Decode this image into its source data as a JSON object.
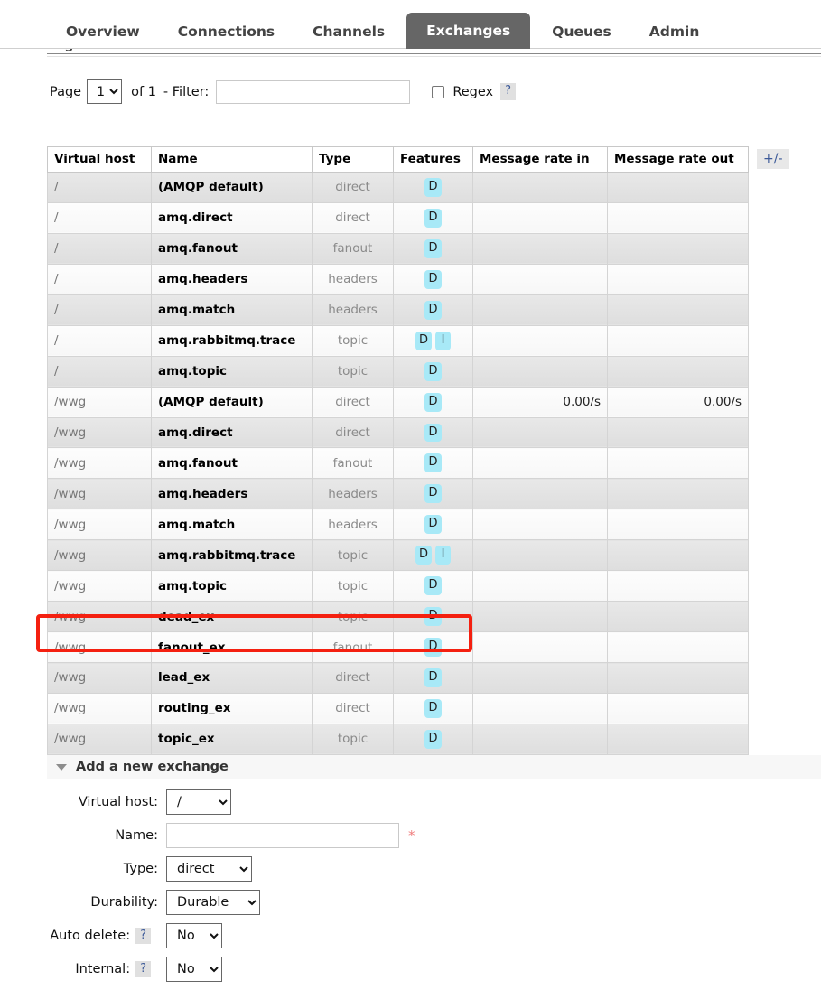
{
  "nav": {
    "tabs": [
      {
        "label": "Overview",
        "active": false
      },
      {
        "label": "Connections",
        "active": false
      },
      {
        "label": "Channels",
        "active": false
      },
      {
        "label": "Exchanges",
        "active": true
      },
      {
        "label": "Queues",
        "active": false
      },
      {
        "label": "Admin",
        "active": false
      }
    ]
  },
  "pagination": {
    "section_label": "Pagination",
    "page_label": "Page",
    "page_value": "1",
    "of_label": "of 1",
    "filter_label": "- Filter:",
    "filter_value": "",
    "filter_placeholder": "",
    "regex_label": "Regex",
    "regex_checked": false,
    "help_label": "?"
  },
  "table": {
    "columns": [
      "Virtual host",
      "Name",
      "Type",
      "Features",
      "Message rate in",
      "Message rate out"
    ],
    "plus_minus_label": "+/-",
    "rows": [
      {
        "vhost": "/",
        "name": "(AMQP default)",
        "type": "direct",
        "features": [
          "D"
        ],
        "rate_in": "",
        "rate_out": ""
      },
      {
        "vhost": "/",
        "name": "amq.direct",
        "type": "direct",
        "features": [
          "D"
        ],
        "rate_in": "",
        "rate_out": ""
      },
      {
        "vhost": "/",
        "name": "amq.fanout",
        "type": "fanout",
        "features": [
          "D"
        ],
        "rate_in": "",
        "rate_out": ""
      },
      {
        "vhost": "/",
        "name": "amq.headers",
        "type": "headers",
        "features": [
          "D"
        ],
        "rate_in": "",
        "rate_out": ""
      },
      {
        "vhost": "/",
        "name": "amq.match",
        "type": "headers",
        "features": [
          "D"
        ],
        "rate_in": "",
        "rate_out": ""
      },
      {
        "vhost": "/",
        "name": "amq.rabbitmq.trace",
        "type": "topic",
        "features": [
          "D",
          "I"
        ],
        "rate_in": "",
        "rate_out": ""
      },
      {
        "vhost": "/",
        "name": "amq.topic",
        "type": "topic",
        "features": [
          "D"
        ],
        "rate_in": "",
        "rate_out": ""
      },
      {
        "vhost": "/wwg",
        "name": "(AMQP default)",
        "type": "direct",
        "features": [
          "D"
        ],
        "rate_in": "0.00/s",
        "rate_out": "0.00/s"
      },
      {
        "vhost": "/wwg",
        "name": "amq.direct",
        "type": "direct",
        "features": [
          "D"
        ],
        "rate_in": "",
        "rate_out": ""
      },
      {
        "vhost": "/wwg",
        "name": "amq.fanout",
        "type": "fanout",
        "features": [
          "D"
        ],
        "rate_in": "",
        "rate_out": ""
      },
      {
        "vhost": "/wwg",
        "name": "amq.headers",
        "type": "headers",
        "features": [
          "D"
        ],
        "rate_in": "",
        "rate_out": ""
      },
      {
        "vhost": "/wwg",
        "name": "amq.match",
        "type": "headers",
        "features": [
          "D"
        ],
        "rate_in": "",
        "rate_out": ""
      },
      {
        "vhost": "/wwg",
        "name": "amq.rabbitmq.trace",
        "type": "topic",
        "features": [
          "D",
          "I"
        ],
        "rate_in": "",
        "rate_out": ""
      },
      {
        "vhost": "/wwg",
        "name": "amq.topic",
        "type": "topic",
        "features": [
          "D"
        ],
        "rate_in": "",
        "rate_out": ""
      },
      {
        "vhost": "/wwg",
        "name": "dead_ex",
        "type": "topic",
        "features": [
          "D"
        ],
        "rate_in": "",
        "rate_out": ""
      },
      {
        "vhost": "/wwg",
        "name": "fanout_ex",
        "type": "fanout",
        "features": [
          "D"
        ],
        "rate_in": "",
        "rate_out": "",
        "highlighted": true
      },
      {
        "vhost": "/wwg",
        "name": "lead_ex",
        "type": "direct",
        "features": [
          "D"
        ],
        "rate_in": "",
        "rate_out": ""
      },
      {
        "vhost": "/wwg",
        "name": "routing_ex",
        "type": "direct",
        "features": [
          "D"
        ],
        "rate_in": "",
        "rate_out": ""
      },
      {
        "vhost": "/wwg",
        "name": "topic_ex",
        "type": "topic",
        "features": [
          "D"
        ],
        "rate_in": "",
        "rate_out": ""
      }
    ]
  },
  "add_exchange": {
    "section_title": "Add a new exchange",
    "fields": {
      "vhost": {
        "label": "Virtual host:",
        "value": "/"
      },
      "name": {
        "label": "Name:",
        "value": "",
        "placeholder": "",
        "required_marker": "*"
      },
      "type": {
        "label": "Type:",
        "value": "direct"
      },
      "durability": {
        "label": "Durability:",
        "value": "Durable"
      },
      "auto_delete": {
        "label": "Auto delete:",
        "value": "No",
        "help": "?"
      },
      "internal": {
        "label": "Internal:",
        "value": "No",
        "help": "?"
      }
    }
  },
  "colors": {
    "active_tab_bg": "#666666",
    "feature_badge_bg": "#a8e9f7",
    "highlight_box": "#f42010",
    "link_blue": "#3b5998"
  }
}
